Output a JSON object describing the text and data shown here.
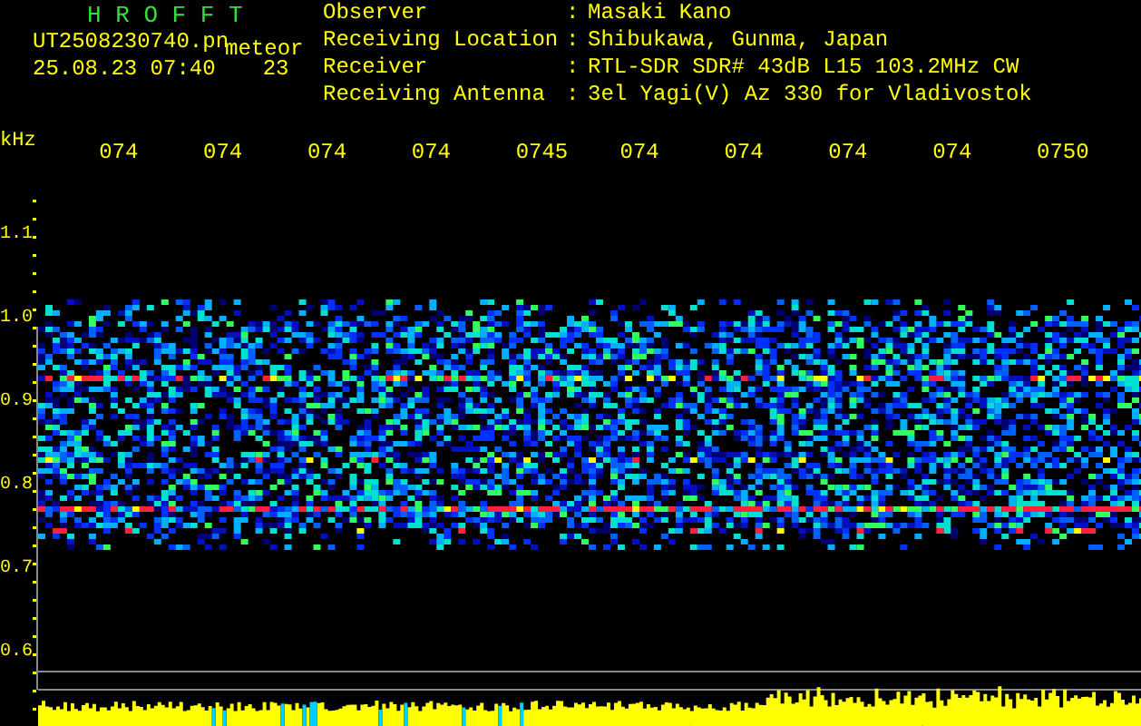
{
  "header": {
    "title": "H R O F F T",
    "filename": "UT2508230740.pn",
    "mode": "meteor",
    "datetime": "25.08.23 07:40",
    "counter": "23"
  },
  "info": [
    {
      "label": "Observer",
      "separator": ":",
      "value": "Masaki Kano"
    },
    {
      "label": "Receiving Location",
      "separator": ":",
      "value": "Shibukawa, Gunma, Japan"
    },
    {
      "label": "Receiver",
      "separator": ":",
      "value": "RTL-SDR SDR# 43dB L15 103.2MHz CW"
    },
    {
      "label": "Receiving Antenna",
      "separator": ":",
      "value": "3el Yagi(V) Az 330 for Vladivostok"
    }
  ],
  "time_axis": {
    "labels": [
      "074",
      "074",
      "074",
      "074",
      "0745",
      "074",
      "074",
      "074",
      "074",
      "0750"
    ]
  },
  "freq_axis": {
    "unit": "kHz",
    "labels": [
      "1.1",
      "1.0",
      "0.9",
      "0.8",
      "0.7",
      "0.6"
    ]
  }
}
